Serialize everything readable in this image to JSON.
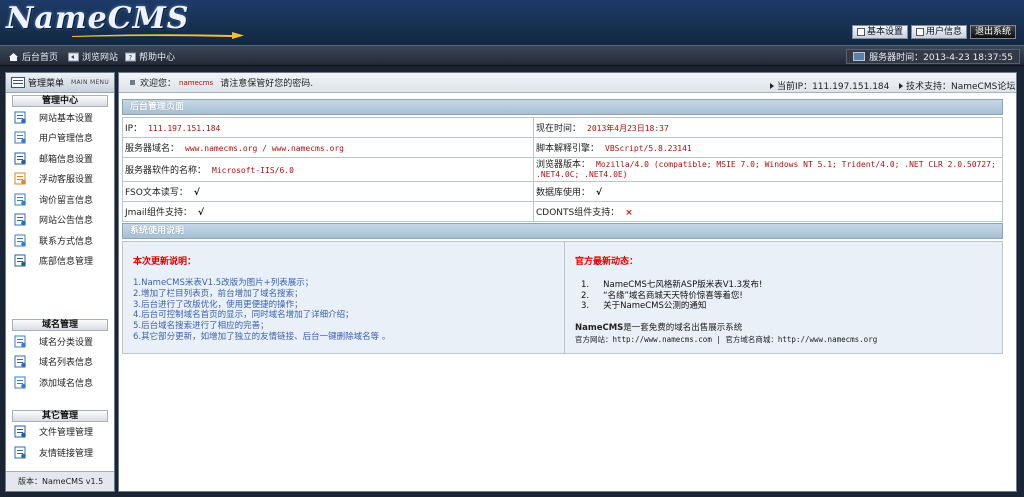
{
  "header": {
    "logo_text": "NameCMS",
    "links": [
      {
        "label": "基本设置",
        "icon": "gear-icon"
      },
      {
        "label": "用户信息",
        "icon": "user-icon"
      },
      {
        "label": "退出系统",
        "icon": "logout-icon"
      }
    ]
  },
  "nav": {
    "items": [
      {
        "label": "后台首页",
        "icon": "home-icon"
      },
      {
        "label": "浏览网站",
        "icon": "browse-icon"
      },
      {
        "label": "帮助中心",
        "icon": "help-icon"
      }
    ],
    "server_time": "服务器时间：2013-4-23 18:37:55"
  },
  "sidebar": {
    "header": "管理菜单",
    "header_sub": "MAIN MENU",
    "sections": [
      {
        "title": "管理中心",
        "items": [
          "网站基本设置",
          "用户管理信息",
          "邮箱信息设置",
          "浮动客服设置",
          "询价留言信息",
          "网站公告信息",
          "联系方式信息",
          "底部信息管理"
        ]
      },
      {
        "title": "域名管理",
        "items": [
          "域名分类设置",
          "域名列表信息",
          "添加域名信息"
        ]
      },
      {
        "title": "其它管理",
        "items": [
          "文件管理管理",
          "友情链接管理"
        ]
      }
    ],
    "footer": "版本：NameCMS v1.5"
  },
  "welcome": {
    "prefix": "欢迎您：",
    "username": "namecms",
    "suffix": "请注意保管好您的密码.",
    "current_ip": "当前IP：111.197.151.184",
    "tech_support": "技术支持：NameCMS论坛"
  },
  "panel1": {
    "title": "后台管理页面",
    "rows": [
      [
        {
          "label": "IP：",
          "value": "111.197.151.184"
        },
        {
          "label": "现在时间：",
          "value": "2013年4月23日18:37"
        }
      ],
      [
        {
          "label": "服务器域名：",
          "value": "www.namecms.org / www.namecms.org"
        },
        {
          "label": "脚本解释引擎：",
          "value": "VBScript/5.8.23141"
        }
      ],
      [
        {
          "label": "服务器软件的名称：",
          "value": "Microsoft-IIS/6.0"
        },
        {
          "label": "浏览器版本：",
          "value": "Mozilla/4.0 (compatible; MSIE 7.0; Windows NT 5.1; Trident/4.0; .NET CLR 2.0.50727; .NET4.0C; .NET4.0E)"
        }
      ],
      [
        {
          "label": "FSO文本读写：",
          "value": "√"
        },
        {
          "label": "数据库使用：",
          "value": "√"
        }
      ],
      [
        {
          "label": "Jmail组件支持：",
          "value": "√"
        },
        {
          "label": "CDONTS组件支持：",
          "value": "×"
        }
      ]
    ]
  },
  "panel2": {
    "title": "系统使用说明",
    "updates_title": "本次更新说明：",
    "updates": [
      "1.NameCMS米表V1.5改版为图片+列表展示；",
      "2.增加了栏目列表页，前台增加了域名搜索；",
      "3.后台进行了改版优化，使用更便捷的操作；",
      "4.后台可控制域名首页的显示，同时域名增加了详细介绍；",
      "5.后台域名搜索进行了相应的完善；",
      "6.其它部分更新，如增加了独立的友情链接、后台一键删除域名等 。"
    ],
    "news_title": "官方最新动态：",
    "news": [
      {
        "num": "1.",
        "text": "NameCMS七风格新ASP版米表V1.3发布!"
      },
      {
        "num": "2.",
        "text": "“名缘”域名商城天天特价惊喜等着您!"
      },
      {
        "num": "3.",
        "text": "关于NameCMS公测的通知"
      }
    ],
    "about_name": "NameCMS",
    "about_suffix": "是一套免费的域名出售展示系统",
    "about_sites": "官方网站：http://www.namecms.com  |  官方域名商城：http://www.namecms.org"
  }
}
